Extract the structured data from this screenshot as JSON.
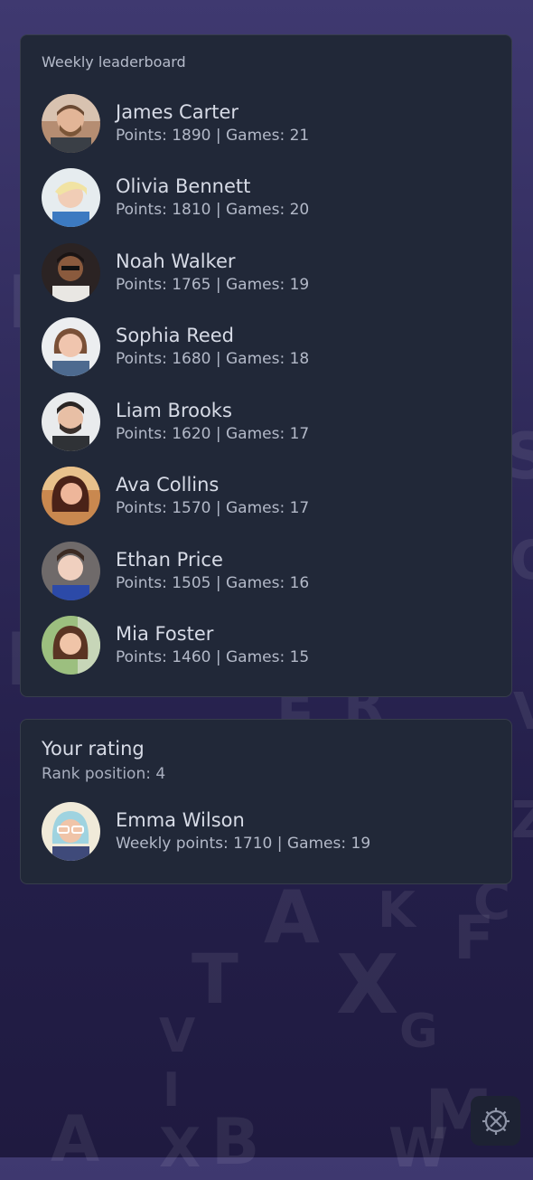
{
  "leaderboard": {
    "title": "Weekly leaderboard",
    "entries": [
      {
        "name": "James Carter",
        "stats": "Points: 1890 | Games: 21"
      },
      {
        "name": "Olivia Bennett",
        "stats": "Points: 1810 | Games: 20"
      },
      {
        "name": "Noah Walker",
        "stats": "Points: 1765 | Games: 19"
      },
      {
        "name": "Sophia Reed",
        "stats": "Points: 1680 | Games: 18"
      },
      {
        "name": "Liam Brooks",
        "stats": "Points: 1620 | Games: 17"
      },
      {
        "name": "Ava Collins",
        "stats": "Points: 1570 | Games: 17"
      },
      {
        "name": "Ethan Price",
        "stats": "Points: 1505 | Games: 16"
      },
      {
        "name": "Mia Foster",
        "stats": "Points: 1460 | Games: 15"
      }
    ]
  },
  "your_rating": {
    "title": "Your rating",
    "rank": "Rank position: 4",
    "name": "Emma Wilson",
    "stats": "Weekly points: 1710 | Games: 19"
  },
  "settings": {
    "icon": "settings-tools-icon"
  }
}
